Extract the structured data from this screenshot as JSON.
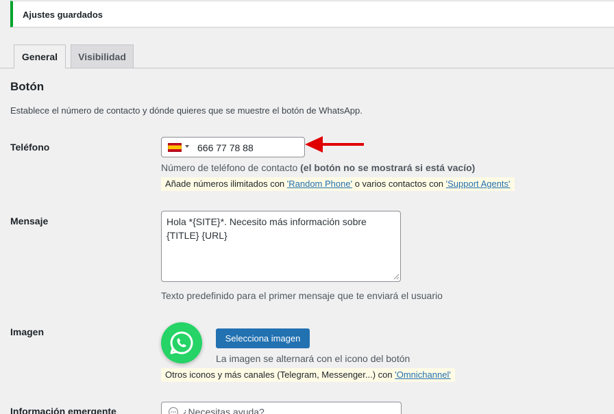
{
  "notice": {
    "text": "Ajustes guardados"
  },
  "tabs": [
    {
      "label": "General",
      "active": true
    },
    {
      "label": "Visibilidad",
      "active": false
    }
  ],
  "section": {
    "title": "Botón",
    "description": "Establece el número de contacto y dónde quieres que se muestre el botón de WhatsApp."
  },
  "phone": {
    "label": "Teléfono",
    "country_flag": "es-flag-icon",
    "value": "666 77 78 88",
    "help_prefix": "Número de teléfono de contacto ",
    "help_bold": "(el botón no se mostrará si está vacío)",
    "promo_prefix": "Añade números ilimitados con ",
    "promo_link1": "'Random Phone'",
    "promo_middle": " o varios contactos con ",
    "promo_link2": "'Support Agents'"
  },
  "message": {
    "label": "Mensaje",
    "value": "Hola *{SITE}*. Necesito más información sobre\n{TITLE} {URL}",
    "help": "Texto predefinido para el primer mensaje que te enviará el usuario"
  },
  "image": {
    "label": "Imagen",
    "button_label": "Selecciona imagen",
    "help": "La imagen se alternará con el icono del botón",
    "promo_prefix": "Otros iconos y más canales (Telegram, Messenger...) con ",
    "promo_link": "'Omnichannel'"
  },
  "popup": {
    "label": "Información emergente",
    "placeholder": "¿Necesitas ayuda?"
  },
  "colors": {
    "notice_border": "#00a32a",
    "primary_button": "#2271b1",
    "whatsapp_green": "#25d366",
    "annotation_arrow": "#e00000",
    "promo_background": "#fffbe5"
  }
}
